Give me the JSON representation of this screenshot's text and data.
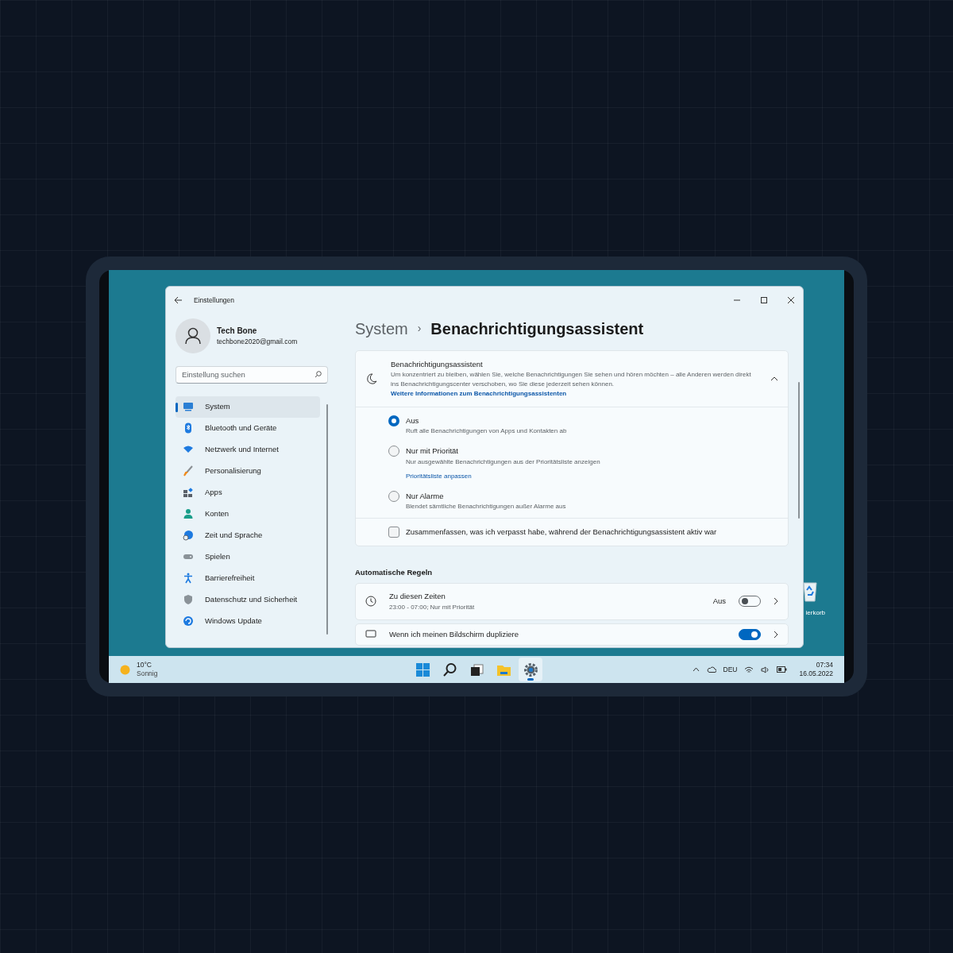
{
  "window": {
    "title": "Einstellungen"
  },
  "user": {
    "name": "Tech Bone",
    "email": "techbone2020@gmail.com"
  },
  "search": {
    "placeholder": "Einstellung suchen"
  },
  "nav": [
    {
      "label": "System",
      "kind": "system",
      "selected": true
    },
    {
      "label": "Bluetooth und Geräte",
      "kind": "bluetooth",
      "selected": false
    },
    {
      "label": "Netzwerk und Internet",
      "kind": "network",
      "selected": false
    },
    {
      "label": "Personalisierung",
      "kind": "brush",
      "selected": false
    },
    {
      "label": "Apps",
      "kind": "apps",
      "selected": false
    },
    {
      "label": "Konten",
      "kind": "person",
      "selected": false
    },
    {
      "label": "Zeit und Sprache",
      "kind": "globe",
      "selected": false
    },
    {
      "label": "Spielen",
      "kind": "gamepad",
      "selected": false
    },
    {
      "label": "Barrierefreiheit",
      "kind": "accessibility",
      "selected": false
    },
    {
      "label": "Datenschutz und Sicherheit",
      "kind": "shield",
      "selected": false
    },
    {
      "label": "Windows Update",
      "kind": "update",
      "selected": false
    }
  ],
  "breadcrumb": {
    "parent": "System",
    "separator": "›",
    "current": "Benachrichtigungsassistent"
  },
  "focus_card": {
    "title": "Benachrichtigungsassistent",
    "description": "Um konzentriert zu bleiben, wählen Sie, welche Benachrichtigungen Sie sehen und hören möchten – alle Anderen werden direkt ins Benachrichtigungscenter verschoben, wo Sie diese jederzeit sehen können.",
    "link": "Weitere Informationen zum Benachrichtigungsassistenten",
    "expanded": true,
    "options": [
      {
        "label": "Aus",
        "description": "Ruft alle Benachrichtigungen von Apps und Kontakten ab",
        "selected": true
      },
      {
        "label": "Nur mit Priorität",
        "description": "Nur ausgewählte Benachrichtigungen aus der Prioritätsliste anzeigen",
        "link": "Prioritätsliste anpassen",
        "selected": false
      },
      {
        "label": "Nur Alarme",
        "description": "Blendet sämtliche Benachrichtigungen außer Alarme aus",
        "selected": false
      }
    ],
    "checkbox": {
      "label": "Zusammenfassen, was ich verpasst habe, während der Benachrichtigungsassistent aktiv war",
      "checked": false
    }
  },
  "rules_section": {
    "heading": "Automatische Regeln",
    "rules": [
      {
        "kind": "clock",
        "title": "Zu diesen Zeiten",
        "subtitle": "23:00 - 07:00; Nur mit Priorität",
        "toggle_label": "Aus",
        "on": false
      },
      {
        "kind": "screen",
        "title": "Wenn ich meinen Bildschirm dupliziere",
        "on": true
      }
    ]
  },
  "desktop": {
    "icon_label": "ierkorb"
  },
  "taskbar": {
    "weather": {
      "temperature": "10°C",
      "condition": "Sonnig"
    },
    "apps": [
      {
        "kind": "start",
        "active": false
      },
      {
        "kind": "search",
        "active": false
      },
      {
        "kind": "taskview",
        "active": false
      },
      {
        "kind": "explorer",
        "active": false
      },
      {
        "kind": "settings",
        "active": true
      }
    ],
    "language": "DEU",
    "time": "07:34",
    "date": "16.05.2022"
  }
}
